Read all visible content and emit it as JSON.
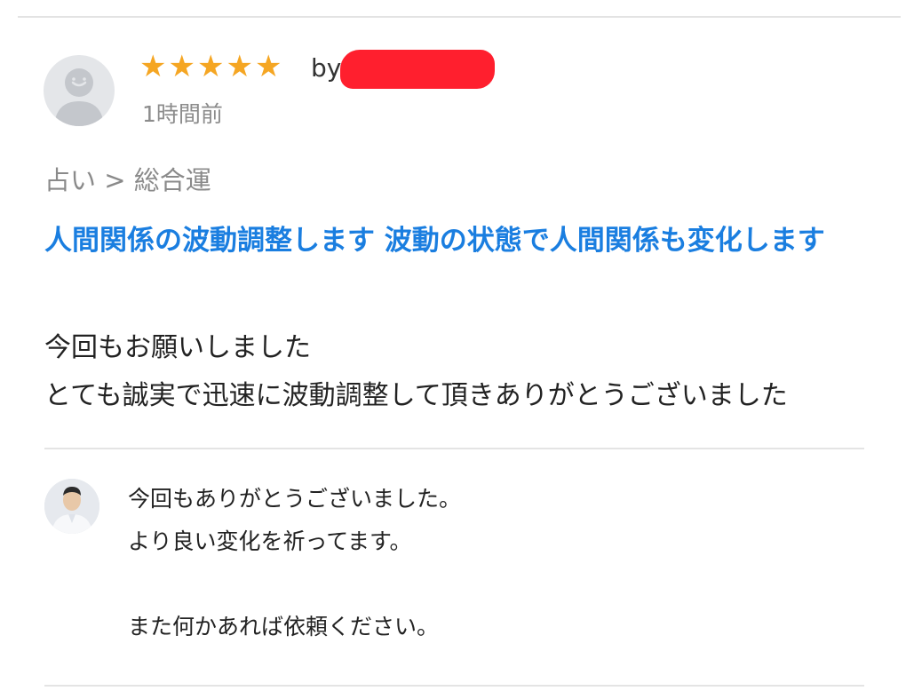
{
  "review": {
    "rating": 5,
    "star_glyphs": [
      "★",
      "★",
      "★",
      "★",
      "★"
    ],
    "by_label": "by",
    "time_ago": "1時間前",
    "category": "占い > 総合運",
    "service_title": "人間関係の波動調整します 波動の状態で人間関係も変化します",
    "text_lines": [
      "今回もお願いしました",
      "とても誠実で迅速に波動調整して頂きありがとうございました"
    ]
  },
  "reply": {
    "lines": [
      "今回もありがとうございました。",
      "より良い変化を祈ってます。",
      "",
      "また何かあれば依頼ください。"
    ]
  },
  "colors": {
    "star": "#f5a623",
    "link": "#1a7ee0",
    "muted": "#8a8a8a",
    "redaction": "#ff1f2e"
  }
}
